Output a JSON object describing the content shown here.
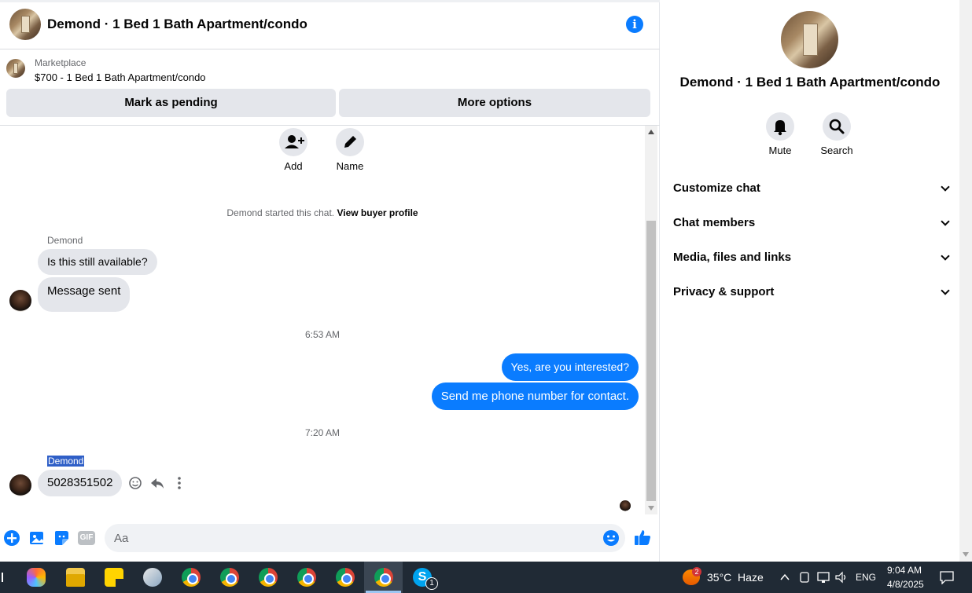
{
  "header": {
    "title": "Demond · 1 Bed 1 Bath Apartment/condo"
  },
  "marketplace": {
    "label": "Marketplace",
    "listing": "$700 - 1 Bed 1 Bath Apartment/condo"
  },
  "actions": {
    "mark_pending": "Mark as pending",
    "more_options": "More options"
  },
  "quick_actions": {
    "add": "Add",
    "name": "Name"
  },
  "system_message": {
    "text": "Demond started this chat.",
    "link": "View buyer profile"
  },
  "messages": [
    {
      "sender": "Demond",
      "text": "Is this still available?"
    },
    {
      "text": "Message sent"
    },
    {
      "time": "6:53 AM"
    },
    {
      "text": "Yes, are you interested?"
    },
    {
      "text": "Send me phone number for contact."
    },
    {
      "time": "7:20 AM"
    },
    {
      "sender": "Demond",
      "text": "5028351502"
    }
  ],
  "composer": {
    "placeholder": "Aa",
    "gif": "GIF"
  },
  "right_panel": {
    "title": "Demond · 1 Bed 1 Bath Apartment/condo",
    "mute": "Mute",
    "search": "Search",
    "sections": [
      "Customize chat",
      "Chat members",
      "Media, files and links",
      "Privacy & support"
    ]
  },
  "taskbar": {
    "weather": "35°C  Haze",
    "weather_badge": "2",
    "lang": "ENG",
    "time": "9:04 AM",
    "date": "4/8/2025",
    "skype_badge": "1"
  },
  "colors": {
    "accent": "#0a7cff",
    "bubble_in": "#e4e6eb",
    "taskbar": "#202a35"
  }
}
